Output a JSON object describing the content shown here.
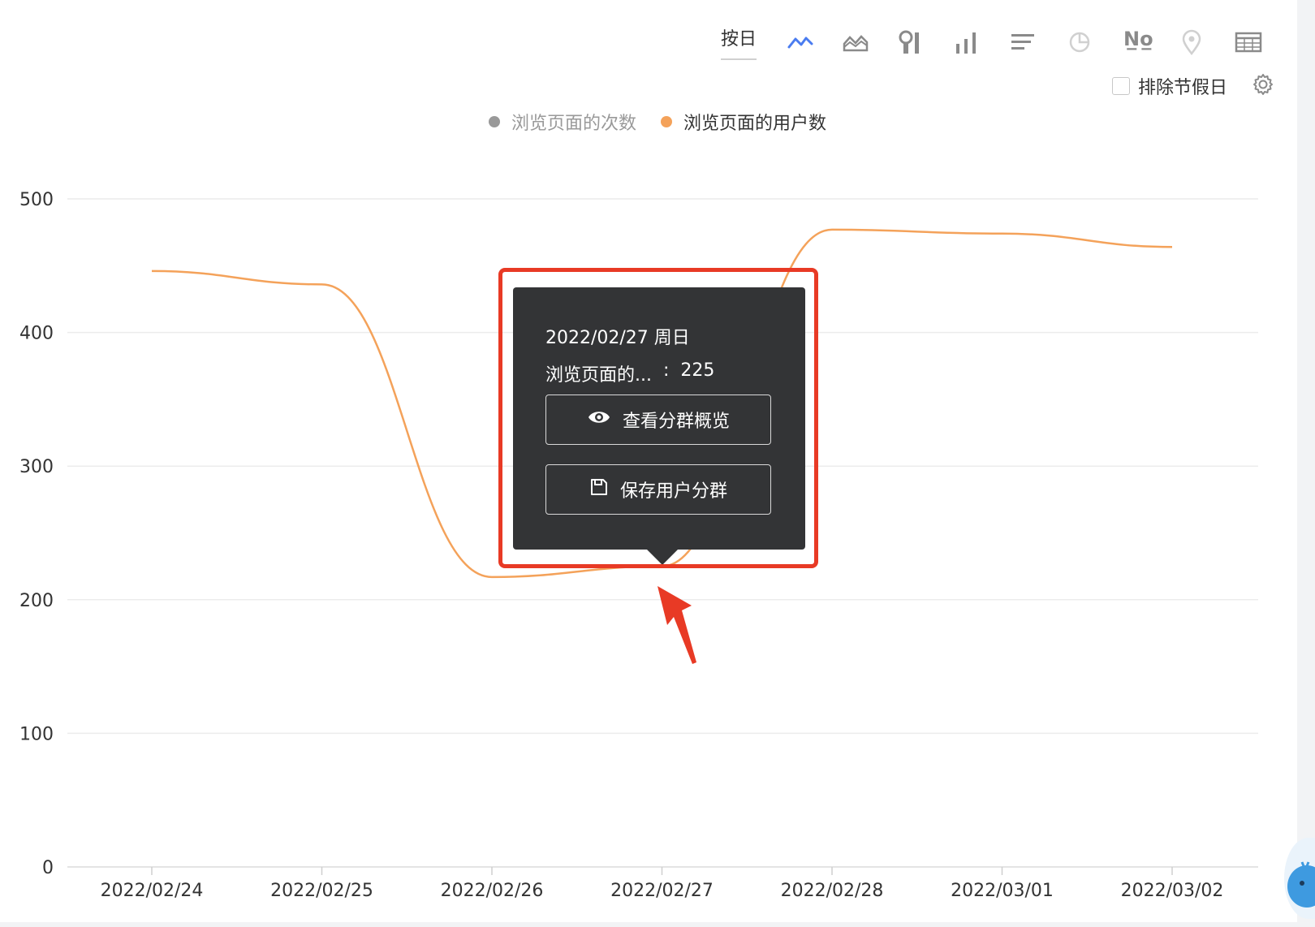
{
  "toolbar": {
    "by_day_label": "按日",
    "number_icon_text": "N̲o̲",
    "icons": [
      "line-chart-icon",
      "area-chart-icon",
      "funnel-chart-icon",
      "bar-chart-icon",
      "horizontal-bar-icon",
      "pie-chart-icon",
      "number-icon",
      "map-pin-icon",
      "table-icon"
    ],
    "active_color": "#4a7cf0",
    "inactive_color": "#8a8a8a"
  },
  "exclude_holidays": {
    "label": "排除节假日",
    "checked": false
  },
  "legend": [
    {
      "label": "浏览页面的次数",
      "color": "#999999",
      "active": false
    },
    {
      "label": "浏览页面的用户数",
      "color": "#f4a25a",
      "active": true
    }
  ],
  "tooltip": {
    "date": "2022/02/27 周日",
    "series_label": "浏览页面的...",
    "separator": ":",
    "value": "225",
    "view_button": "查看分群概览",
    "save_button": "保存用户分群"
  },
  "chart_data": {
    "type": "line",
    "categories": [
      "2022/02/24",
      "2022/02/25",
      "2022/02/26",
      "2022/02/27",
      "2022/02/28",
      "2022/03/01",
      "2022/03/02"
    ],
    "series": [
      {
        "name": "浏览页面的用户数",
        "values": [
          446,
          436,
          217,
          225,
          477,
          474,
          464
        ],
        "color": "#f4a25a"
      }
    ],
    "ylim": [
      0,
      500
    ],
    "yticks": [
      0,
      100,
      200,
      300,
      400,
      500
    ],
    "grid": true,
    "legend_position": "top-center"
  }
}
